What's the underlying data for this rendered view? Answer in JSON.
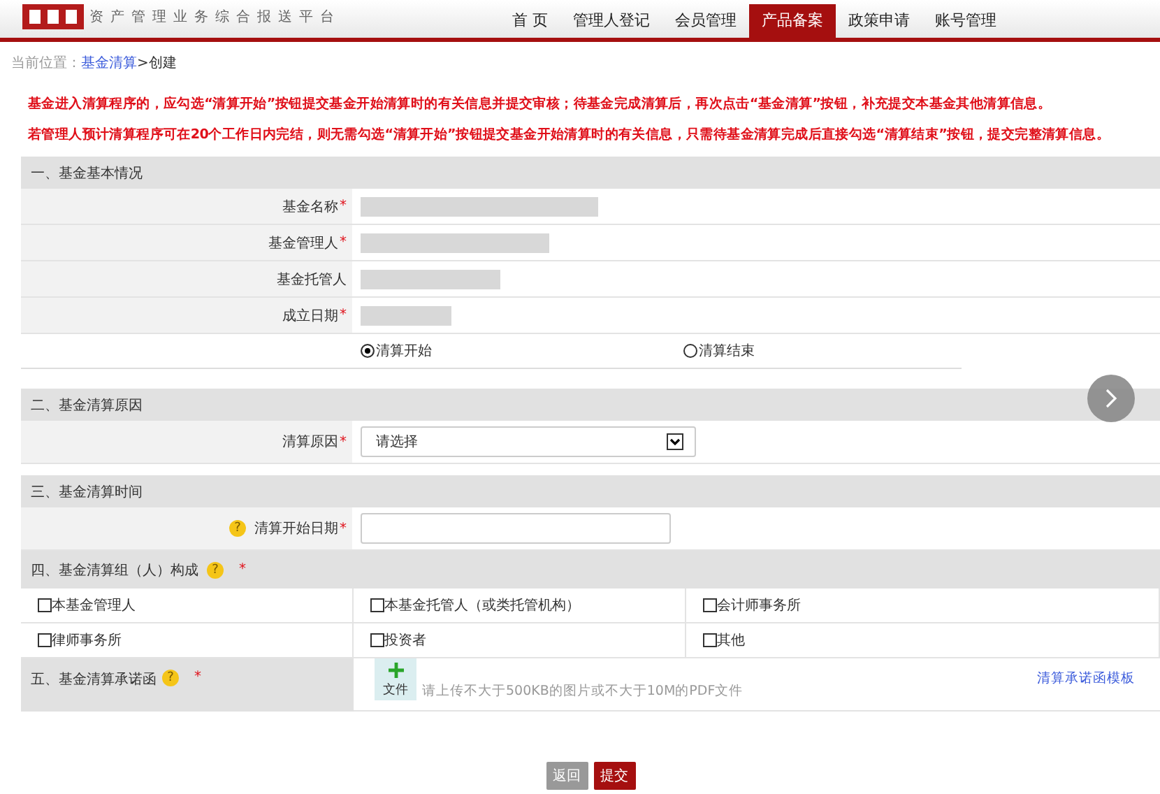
{
  "required_mark": "*",
  "help_mark": "?",
  "header": {
    "subtitle": "资产管理业务综合报送平台",
    "nav": [
      {
        "label": "首 页",
        "selected": false
      },
      {
        "label": "管理人登记",
        "selected": false
      },
      {
        "label": "会员管理",
        "selected": false
      },
      {
        "label": "产品备案",
        "selected": true
      },
      {
        "label": "政策申请",
        "selected": false
      },
      {
        "label": "账号管理",
        "selected": false
      }
    ]
  },
  "breadcrumb": {
    "prefix": "当前位置：",
    "link": "基金清算",
    "sep": ">",
    "current": "创建"
  },
  "notices": [
    "基金进入清算程序的，应勾选“清算开始”按钮提交基金开始清算时的有关信息并提交审核；待基金完成清算后，再次点击“基金清算”按钮，补充提交本基金其他清算信息。",
    "若管理人预计清算程序可在20个工作日内完结，则无需勾选“清算开始”按钮提交基金开始清算时的有关信息，只需待基金清算完成后直接勾选“清算结束”按钮，提交完整清算信息。"
  ],
  "section1": {
    "title": "一、基金基本情况",
    "fields": [
      {
        "label": "基金名称",
        "required": true
      },
      {
        "label": "基金管理人",
        "required": true
      },
      {
        "label": "基金托管人",
        "required": false
      },
      {
        "label": "成立日期",
        "required": true
      }
    ],
    "radios": [
      {
        "label": "清算开始",
        "selected": true
      },
      {
        "label": "清算结束",
        "selected": false
      }
    ]
  },
  "section2": {
    "title": "二、基金清算原因",
    "label": "清算原因",
    "select": "请选择"
  },
  "section3": {
    "title": "三、基金清算时间",
    "label": "清算开始日期"
  },
  "section4": {
    "title": "四、基金清算组（人）构成",
    "options": [
      {
        "label": "本基金管理人",
        "checked": false
      },
      {
        "label": "本基金托管人（或类托管机构）",
        "checked": false
      },
      {
        "label": "会计师事务所",
        "checked": false
      },
      {
        "label": "律师事务所",
        "checked": false
      },
      {
        "label": "投资者",
        "checked": false
      },
      {
        "label": "其他",
        "checked": false
      }
    ]
  },
  "section5": {
    "title": "五、基金清算承诺函",
    "upload": "文件",
    "hint": "请上传不大于500KB的图片或不大于10M的PDF文件",
    "template_link": "清算承诺函模板"
  },
  "buttons": [
    {
      "label": "返回",
      "kind": "secondary"
    },
    {
      "label": "提交",
      "kind": "primary"
    }
  ]
}
